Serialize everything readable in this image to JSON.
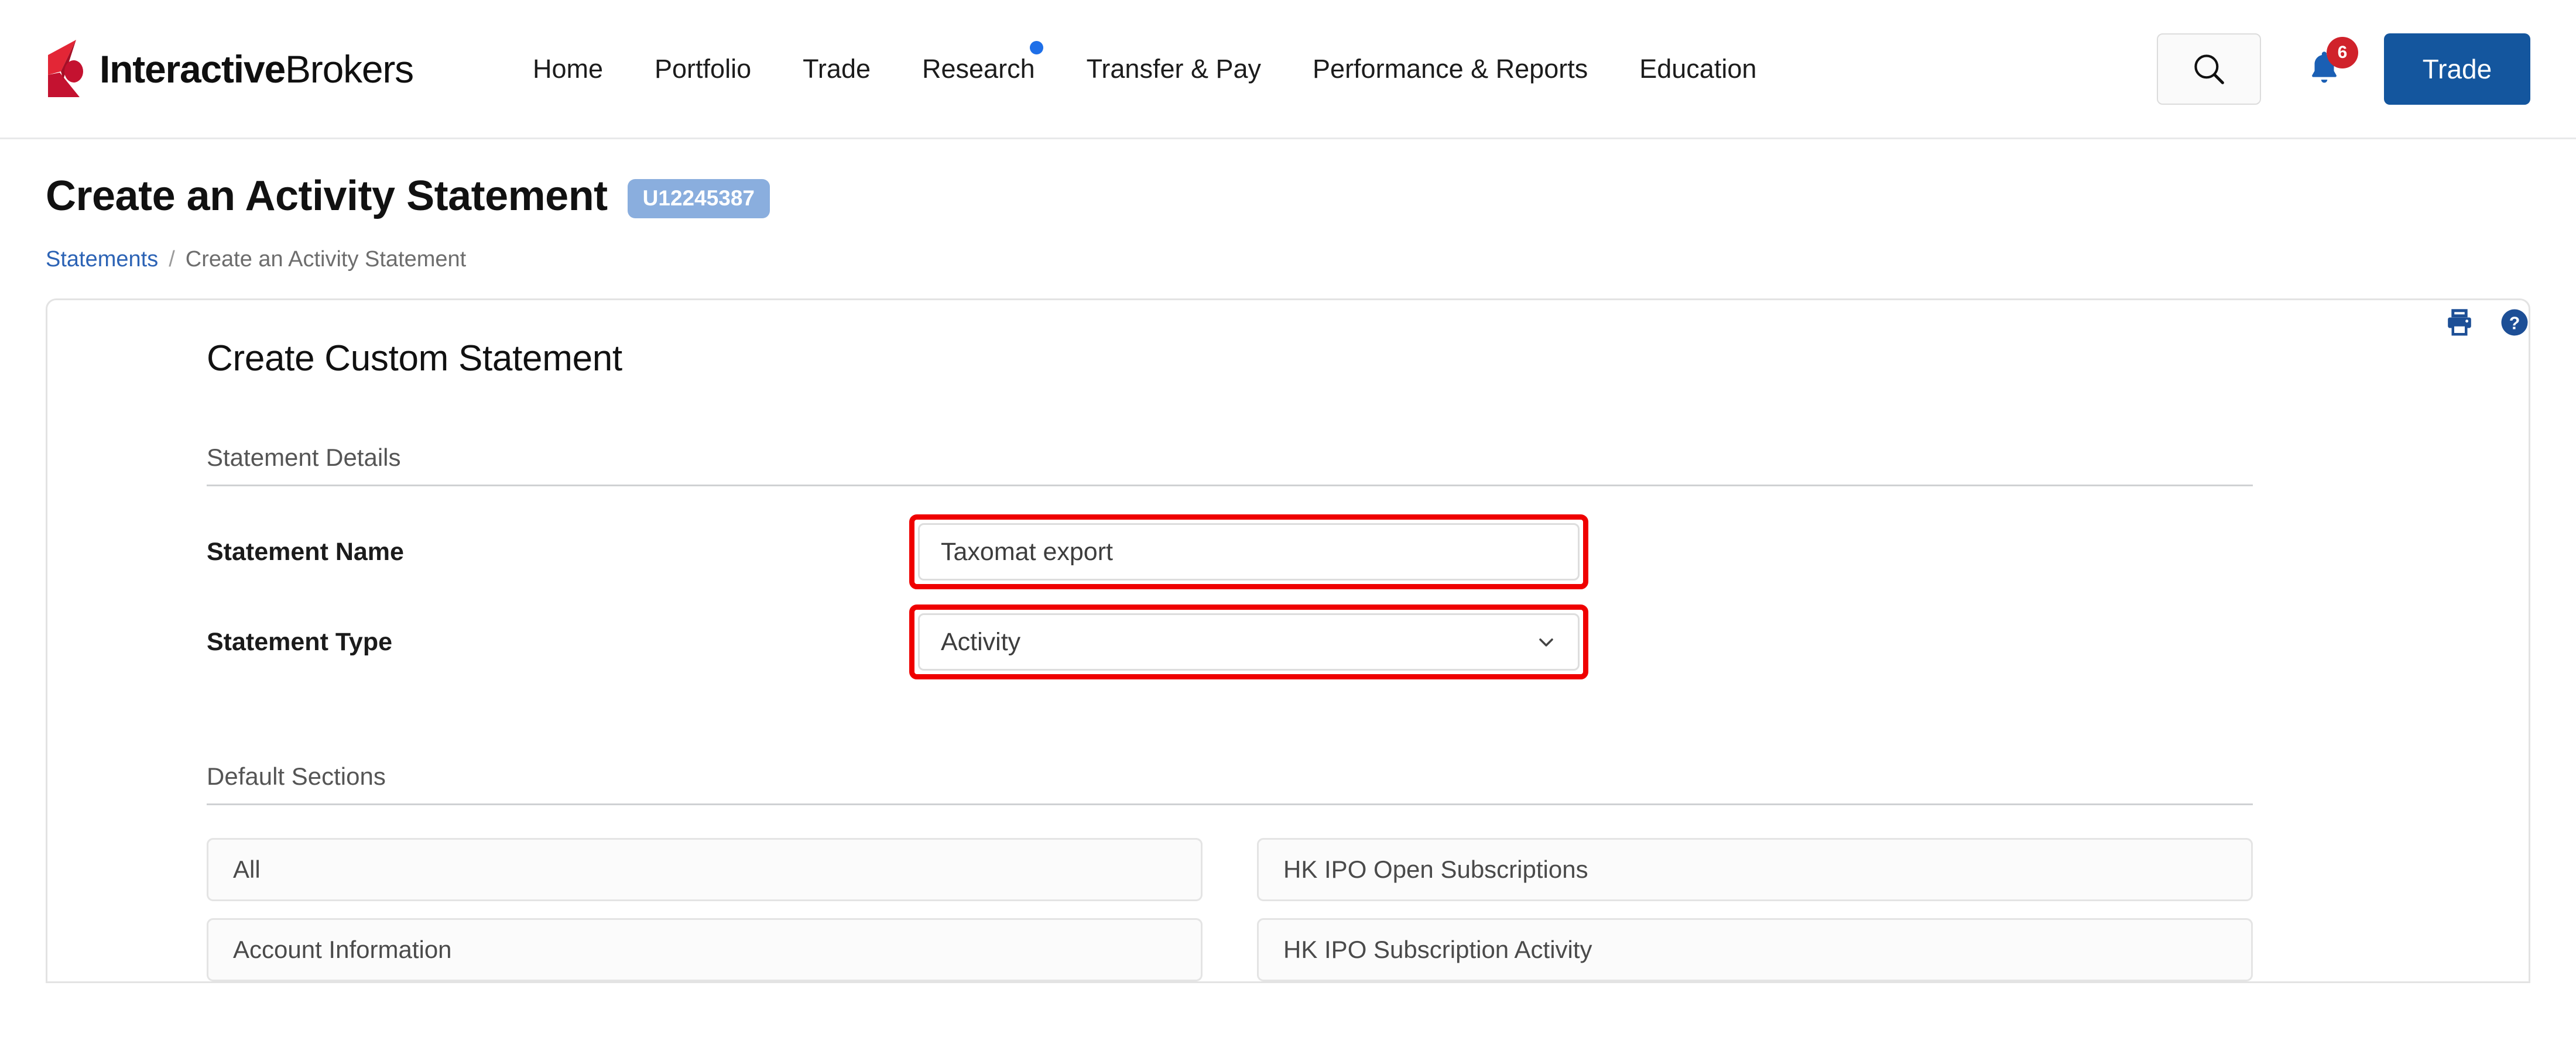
{
  "brand": {
    "name_bold": "Interactive",
    "name_regular": "Brokers",
    "logo_icon": "ibkr-logo-icon"
  },
  "nav": {
    "items": [
      {
        "label": "Home",
        "badge_dot": false
      },
      {
        "label": "Portfolio",
        "badge_dot": false
      },
      {
        "label": "Trade",
        "badge_dot": false
      },
      {
        "label": "Research",
        "badge_dot": true
      },
      {
        "label": "Transfer & Pay",
        "badge_dot": false
      },
      {
        "label": "Performance & Reports",
        "badge_dot": false
      },
      {
        "label": "Education",
        "badge_dot": false
      }
    ],
    "search_icon": "search-icon",
    "bell_icon": "notification-bell-icon",
    "notification_count": "6",
    "trade_button": "Trade"
  },
  "page": {
    "title": "Create an Activity Statement",
    "account_id": "U12245387",
    "print_icon": "print-icon",
    "help_icon": "help-circle-icon"
  },
  "breadcrumb": {
    "parent": "Statements",
    "separator": "/",
    "current": "Create an Activity Statement"
  },
  "card": {
    "title": "Create Custom Statement",
    "statement_details": {
      "heading": "Statement Details",
      "name_label": "Statement Name",
      "name_value": "Taxomat export",
      "name_placeholder": "Statement Name",
      "type_label": "Statement Type",
      "type_value": "Activity",
      "type_chevron_icon": "chevron-down-icon"
    },
    "default_sections": {
      "heading": "Default Sections",
      "left_column": [
        "All",
        "Account Information"
      ],
      "right_column": [
        "HK IPO Open Subscriptions",
        "HK IPO Subscription Activity"
      ]
    }
  },
  "colors": {
    "brand_red": "#cc0000",
    "accent_blue": "#14569e",
    "link_blue": "#2c63b5",
    "badge_blue": "#8aaede",
    "alert_red": "#ef0000",
    "notification_red": "#d0222b",
    "dot_blue": "#1e6fe8"
  }
}
